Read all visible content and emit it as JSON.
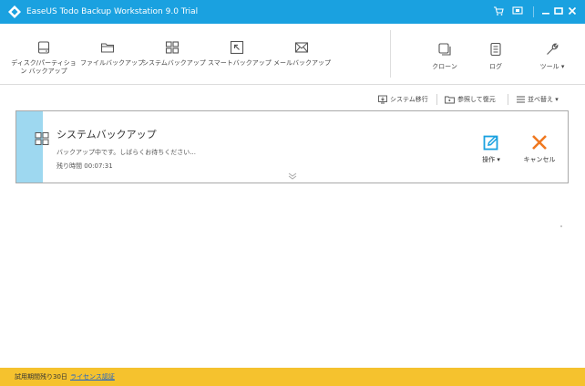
{
  "window": {
    "title": "EaseUS Todo Backup Workstation 9.0 Trial",
    "accent": "#1aa1e0"
  },
  "toolbar": {
    "left_tools": [
      {
        "label": "ディスク/パーティション バックアップ",
        "icon": "disk-icon"
      },
      {
        "label": "ファイルバックアップ",
        "icon": "folder-icon"
      },
      {
        "label": "システムバックアップ",
        "icon": "system-grid-icon"
      },
      {
        "label": "スマートバックアップ",
        "icon": "smart-arrow-icon"
      },
      {
        "label": "メールバックアップ",
        "icon": "mail-icon"
      }
    ],
    "right_tools": [
      {
        "label": "クローン",
        "icon": "clone-icon"
      },
      {
        "label": "ログ",
        "icon": "log-icon"
      },
      {
        "label": "ツール ▾",
        "icon": "wrench-icon"
      }
    ]
  },
  "actions": {
    "migrate": "システム移行",
    "browse_restore": "参照して復元",
    "sort": "並べ替え ▾"
  },
  "task": {
    "title": "システムバックアップ",
    "status": "バックアップ中です。しばらくお待ちください...",
    "remaining_label": "残り時間",
    "remaining_time": "00:07:31",
    "operate_label": "操作 ▾",
    "cancel_label": "キャンセル",
    "stripe_color": "#9ed8f0",
    "cancel_color": "#f07820"
  },
  "footer": {
    "trial_text": "試用期間残り30日",
    "license_link": "ライセンス認証",
    "background": "#f5c22e"
  }
}
